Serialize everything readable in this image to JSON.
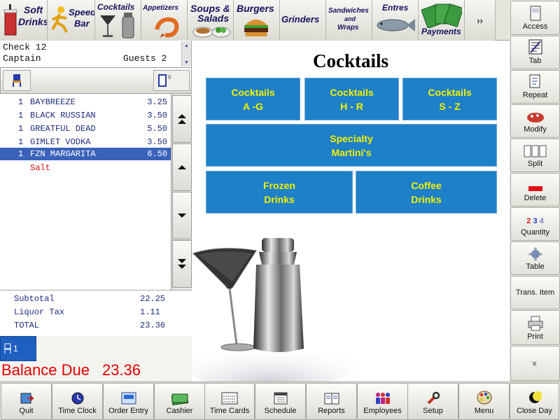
{
  "categories": [
    {
      "id": "soft-drinks",
      "label": "Soft Drinks",
      "line1": "Soft",
      "line2": "Drinks"
    },
    {
      "id": "speed-bar",
      "label": "Speed Bar",
      "line1": "Speed",
      "line2": "Bar"
    },
    {
      "id": "cocktails",
      "label": "Cocktails"
    },
    {
      "id": "appetizers",
      "label": "Appetizers"
    },
    {
      "id": "soups-salads",
      "label": "Soups & Salads",
      "line1": "Soups &",
      "line2": "Salads"
    },
    {
      "id": "burgers",
      "label": "Burgers"
    },
    {
      "id": "grinders",
      "label": "Grinders"
    },
    {
      "id": "sandwiches-wraps",
      "label": "Sandwiches and Wraps",
      "line1": "Sandwiches",
      "line2": "and",
      "line3": "Wraps"
    },
    {
      "id": "entres",
      "label": "Entres"
    },
    {
      "id": "payments",
      "label": "Payments"
    }
  ],
  "more_label": "››",
  "right_buttons": [
    {
      "id": "access",
      "label": "Access",
      "icon": "access-icon"
    },
    {
      "id": "tab",
      "label": "Tab",
      "icon": "tab-icon"
    },
    {
      "id": "repeat",
      "label": "Repeat",
      "icon": "repeat-icon"
    },
    {
      "id": "modify",
      "label": "Modify",
      "icon": "modify-icon"
    },
    {
      "id": "split",
      "label": "Split",
      "icon": "split-icon"
    },
    {
      "id": "delete",
      "label": "Delete",
      "icon": "delete-icon"
    },
    {
      "id": "quantity",
      "label": "Quantity",
      "icon": "quantity-icon",
      "digits": [
        "2",
        "3",
        "4"
      ]
    },
    {
      "id": "table",
      "label": "Table",
      "icon": "table-icon"
    },
    {
      "id": "trans-item",
      "label": "Trans. Item",
      "icon": ""
    },
    {
      "id": "print",
      "label": "Print",
      "icon": "print-icon"
    },
    {
      "id": "scroll-more",
      "label": "»",
      "icon": "chevron-down-icon"
    }
  ],
  "check": {
    "number_label": "Check 12",
    "server": "Captain",
    "guests_label": "Guests 2",
    "seat_count": "6",
    "current_seat": "1"
  },
  "items": [
    {
      "qty": "1",
      "name": "BAYBREEZE",
      "price": "3.25"
    },
    {
      "qty": "1",
      "name": "BLACK RUSSIAN",
      "price": "3.50"
    },
    {
      "qty": "1",
      "name": "GREATFUL DEAD",
      "price": "5.50"
    },
    {
      "qty": "1",
      "name": "GIMLET VODKA",
      "price": "3.50"
    },
    {
      "qty": "1",
      "name": "FZN MARGARITA",
      "price": "6.50",
      "selected": true
    }
  ],
  "modifier": "Salt",
  "totals": {
    "subtotal_label": "Subtotal",
    "subtotal": "22.25",
    "tax_label": "Liquor Tax",
    "tax": "1.11",
    "total_label": "TOTAL",
    "total": "23.36"
  },
  "balance": {
    "label": "Balance Due",
    "amount": "23.36"
  },
  "main": {
    "title": "Cocktails",
    "groups": [
      {
        "id": "cocktails-a-g",
        "line1": "Cocktails",
        "line2": "A -G"
      },
      {
        "id": "cocktails-h-r",
        "line1": "Cocktails",
        "line2": "H - R"
      },
      {
        "id": "cocktails-s-z",
        "line1": "Cocktails",
        "line2": "S - Z"
      },
      {
        "id": "specialty-martinis",
        "line1": "Specialty",
        "line2": "Martini's"
      },
      {
        "id": "frozen-drinks",
        "line1": "Frozen",
        "line2": "Drinks"
      },
      {
        "id": "coffee-drinks",
        "line1": "Coffee",
        "line2": "Drinks"
      }
    ]
  },
  "bottom_buttons": [
    {
      "id": "quit",
      "label": "Quit",
      "icon": "quit-icon"
    },
    {
      "id": "time-clock",
      "label": "Time Clock",
      "icon": "clock-icon"
    },
    {
      "id": "order-entry",
      "label": "Order Entry",
      "icon": "order-entry-icon"
    },
    {
      "id": "cashier",
      "label": "Cashier",
      "icon": "cash-icon"
    },
    {
      "id": "time-cards",
      "label": "Time Cards",
      "icon": "time-cards-icon"
    },
    {
      "id": "schedule",
      "label": "Schedule",
      "icon": "calendar-icon"
    },
    {
      "id": "reports",
      "label": "Reports",
      "icon": "reports-icon"
    },
    {
      "id": "employees",
      "label": "Employees",
      "icon": "employees-icon"
    },
    {
      "id": "setup",
      "label": "Setup",
      "icon": "wrench-icon"
    },
    {
      "id": "menu",
      "label": "Menu",
      "icon": "palette-icon"
    },
    {
      "id": "close-day",
      "label": "Close Day",
      "icon": "moon-icon"
    }
  ],
  "colors": {
    "group_button": "#1e80c8",
    "group_text": "#f3f000",
    "selected_row": "#3a62ba",
    "balance": "#e30000",
    "item_text": "#1d2b80",
    "modifier": "#d01010"
  }
}
